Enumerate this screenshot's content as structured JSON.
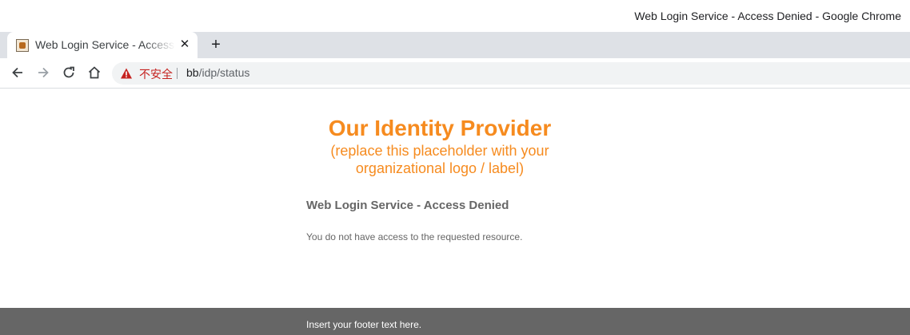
{
  "window": {
    "title": "Web Login Service - Access Denied - Google Chrome"
  },
  "tab": {
    "title": "Web Login Service - Access Denied",
    "close_icon": "close-icon",
    "new_tab_icon": "plus-icon"
  },
  "toolbar": {
    "back_icon": "arrow-left-icon",
    "forward_icon": "arrow-right-icon",
    "reload_icon": "reload-icon",
    "home_icon": "home-icon",
    "security_label": "不安全",
    "url_host": "bb",
    "url_path": "/idp/status"
  },
  "page": {
    "brand_title": "Our Identity Provider",
    "brand_subtitle_line1": "(replace this placeholder with your",
    "brand_subtitle_line2": "organizational logo / label)",
    "heading": "Web Login Service - Access Denied",
    "message": "You do not have access to the requested resource.",
    "footer": "Insert your footer text here."
  },
  "colors": {
    "brand": "#f68b1f",
    "text": "#666666",
    "footer_bg": "#666666",
    "warning": "#c5221f"
  }
}
